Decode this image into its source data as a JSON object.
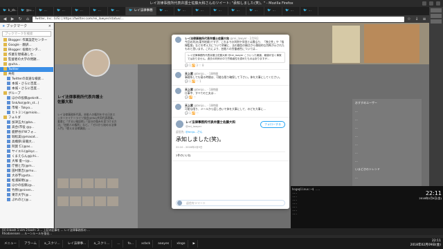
{
  "window": {
    "title": "レイ法律事務所代表弁護士佐藤大和さんのツイート: \"承知しました(笑)。\" - Mozilla Firefox"
  },
  "tabs": [
    {
      "label": "b_zb...",
      "active": false
    },
    {
      "label": "@u...",
      "active": false
    },
    {
      "label": "...",
      "active": false
    },
    {
      "label": "...",
      "active": false
    },
    {
      "label": "...",
      "active": false
    },
    {
      "label": "...",
      "active": false
    },
    {
      "label": "...",
      "active": false
    },
    {
      "label": "レイ法律事務",
      "active": true
    },
    {
      "label": "...",
      "active": false
    },
    {
      "label": "...",
      "active": false
    },
    {
      "label": "...",
      "active": false
    },
    {
      "label": "...",
      "active": false
    },
    {
      "label": "...",
      "active": false
    },
    {
      "label": "...",
      "active": false
    },
    {
      "label": "...",
      "active": false
    },
    {
      "label": "...",
      "active": false
    },
    {
      "label": "...",
      "active": false
    }
  ],
  "nav": {
    "url": "Twitter, Inc. (US) | https://twitter.com/rei_lawyer/status/..."
  },
  "sidebar": {
    "title": "ブックマーク",
    "search_placeholder": "ブックマークを検索",
    "items": [
      {
        "label": "Blogger: 作業設定センター",
        "indent": 1
      },
      {
        "label": "Google - 翻訳...",
        "indent": 1
      },
      {
        "label": "Blogger: 投稿センタ...",
        "indent": 1
      },
      {
        "label": "作業を現場通しセ...",
        "indent": 1
      },
      {
        "label": "監督者の大学の問題...",
        "indent": 1
      },
      {
        "label": "@uha...",
        "indent": 1
      },
      {
        "label": "Twitter",
        "indent": 1,
        "selected": true
      },
      {
        "label": "共有",
        "indent": 1
      },
      {
        "label": "Twitterの高速な検索...",
        "indent": 2
      },
      {
        "label": "本城・さらに百度...",
        "indent": 2
      },
      {
        "label": "本城・さらに百度...",
        "indent": 2
      },
      {
        "label": "グループ",
        "indent": 1
      },
      {
        "label": "ほかの投稿@ekrdt...",
        "indent": 2
      },
      {
        "label": "Snk/ko(@dn_st...)",
        "indent": 2
      },
      {
        "label": "市場 - Tokyo...",
        "indent": 2
      },
      {
        "label": "ヒトミン(@miolo...",
        "indent": 2
      },
      {
        "label": "フォルダ",
        "indent": 1
      },
      {
        "label": "加津五大(@ba...",
        "indent": 2
      },
      {
        "label": "高合(市役 @y...",
        "indent": 2
      },
      {
        "label": "鹿野谷(FWフォ...",
        "indent": 2
      },
      {
        "label": "堀松美(@masat...",
        "indent": 2
      },
      {
        "label": "高橋厚(日職大...",
        "indent": 2
      },
      {
        "label": "阿賀 仁(@as...",
        "indent": 2
      },
      {
        "label": "ヤイエル(@ikyc...",
        "indent": 2
      },
      {
        "label": "くまえらん@jchi...",
        "indent": 2
      },
      {
        "label": "大塚 俊一(@...",
        "indent": 2
      },
      {
        "label": "庁捜と元(@m...",
        "indent": 2
      },
      {
        "label": "田村豊吉(@mu...",
        "indent": 2
      },
      {
        "label": "大谷芋(@sta...",
        "indent": 2
      },
      {
        "label": "松浦知明(@...",
        "indent": 2
      },
      {
        "label": "ほかの投稿(@...",
        "indent": 2
      },
      {
        "label": "竹原(@ninen...",
        "indent": 2
      },
      {
        "label": "東京大学(@...",
        "indent": 2
      },
      {
        "label": "ぷれのと(@...",
        "indent": 2
      }
    ]
  },
  "profile": {
    "name": "レイ法律事務所代表弁護士\n佐藤大和",
    "bio": "レイ法律事務所代表。芸能人の権利を守る日本エンターテイナーライツ協会(JERA)共同代表理事。著書に「ずるい暗記術」「自分の強みを見つける方法」「芸能人の権利」など。「ゼロから始める法律入門」「使える法律講座」..."
  },
  "modal": {
    "tweets": [
      {
        "name": "レイ法律事務所代表弁護士佐藤大和",
        "handle": "@rei_lawyer · 2月9日",
        "text": "今回の判決(東京地裁)ですが、これまでの判例や学説とは異なり、「独立性」や「指揮監督」などの考え方について明確に、法の趣旨の観点から積極的な判断が示されたものと思います。これにより、芸能人の労働者性については...",
        "quote": "レイ法律事務所代表弁護士佐藤大和 @rei_lawyer\nこういった報道、報道が全く事実ではありません。過去の判例の中で労働者性を認めたものはありますが…",
        "acts": "💬 1   🔁 3   ♡ 8"
      },
      {
        "name": "天上家",
        "handle": "@tenjo... · 18時間",
        "text": "事務所しても寝る時間は、可能な限り確保して下さい。体を大事にしてください。",
        "acts": "💬 1   🔁   ♡ 1"
      },
      {
        "name": "天上家",
        "handle": "@tenjo... · 18時間",
        "text": "仕事中、すべての工夫は...",
        "acts": "💬   🔁   ♡"
      },
      {
        "name": "天上家",
        "handle": "@tenjo... · 18時間",
        "text": "可能な限り、メールから話し合いで体を大事にして、のどを大事に...",
        "acts": "💬 1   🔁   ♡"
      }
    ],
    "main": {
      "name": "レイ法律事務所代表弁護士佐藤大和",
      "handle": "@rei_lawyer",
      "follow": "フォローする",
      "reply_to_label": "返信先:",
      "reply_to_handle": "@tenjo...さん",
      "text": "承知しました(笑)。",
      "time": "22:10 - 2018年2月9日",
      "stats": "2件のいいね"
    },
    "reply_placeholder": "返信をツイート"
  },
  "right_col": {
    "items": [
      "おすすめユーザー",
      "...",
      "...",
      "...",
      "...",
      "...",
      "...",
      "...",
      "いまどきのトレンド",
      "...",
      "..."
    ]
  },
  "terminal": {
    "lines": [
      "hoge@linux:~$ ...",
      "...",
      "...",
      "...",
      "...",
      "...",
      "...",
      "..."
    ]
  },
  "clock": {
    "time": "22:11",
    "date": "2018年2月9日(金)"
  },
  "status": {
    "line1": "[0] 0:bash 1:vim 2:bash- 3:...    上記の記事を ... レイ法律事務所の ...",
    "line2": "Rhodaneisen ... ルーンルールを強化..."
  },
  "taskbar": {
    "items": [
      "メニュー",
      "アラーム",
      "a_スクリ...",
      "レイ法律事...",
      "a_スクリ...",
      "...",
      "fo...",
      "xcbck",
      "aaayes",
      "xlogo",
      "▶"
    ],
    "clock": "22:11\n2018年02月09日(金)"
  }
}
